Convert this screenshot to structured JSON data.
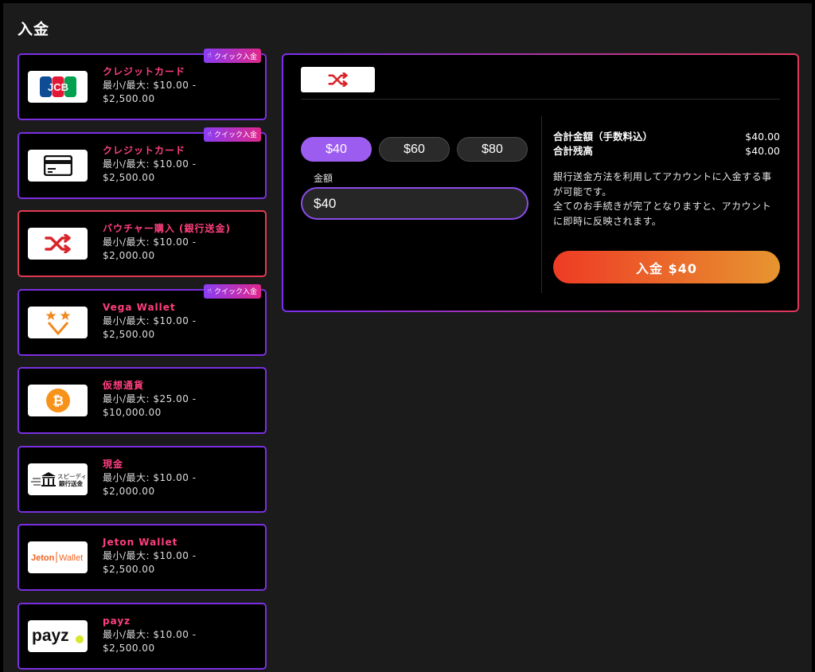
{
  "page": {
    "title": "入金"
  },
  "methods": [
    {
      "name": "クレジットカード",
      "limits": "最小/最大: $10.00 -",
      "limits_max": "$2,500.00",
      "quick": "クイック入金",
      "logo": "jcb-logo",
      "logo_text": "JCB"
    },
    {
      "name": "クレジットカード",
      "limits": "最小/最大: $10.00 -",
      "limits_max": "$2,500.00",
      "quick": "クイック入金",
      "logo": "card-icon"
    },
    {
      "name": "バウチャー購入 (銀行送金)",
      "limits": "最小/最大: $10.00 -",
      "limits_max": "$2,000.00",
      "logo": "shuffle-icon",
      "selected": true
    },
    {
      "name": "Vega Wallet",
      "limits": "最小/最大: $10.00 -",
      "limits_max": "$2,500.00",
      "quick": "クイック入金",
      "logo": "vega-wallet-logo"
    },
    {
      "name": "仮想通貨",
      "limits": "最小/最大: $25.00 -",
      "limits_max": "$10,000.00",
      "logo": "bitcoin-icon",
      "logo_text": "₿"
    },
    {
      "name": "現金",
      "limits": "最小/最大: $10.00 -",
      "limits_max": "$2,000.00",
      "logo": "speedy-bank-transfer-logo",
      "logo_text": "スピーディー",
      "logo_text2": "銀行送金"
    },
    {
      "name": "Jeton Wallet",
      "limits": "最小/最大: $10.00 -",
      "limits_max": "$2,500.00",
      "logo": "jeton-wallet-logo",
      "logo_text": "Jeton",
      "logo_text2": "Wallet"
    },
    {
      "name": "payz",
      "limits": "最小/最大: $10.00 -",
      "limits_max": "$2,500.00",
      "logo": "payz-logo",
      "logo_text": "payz"
    }
  ],
  "panel": {
    "presets": [
      "$40",
      "$60",
      "$80"
    ],
    "active_preset": "$40",
    "amount_label": "金額",
    "amount_value": "$40",
    "total_label": "合計金額（手数料込）",
    "total_value": "$40.00",
    "balance_label": "合計残高",
    "balance_value": "$40.00",
    "desc1": "銀行送金方法を利用してアカウントに入金する事が可能です。",
    "desc2": "全てのお手続きが完了となりますと、アカウントに即時に反映されます。",
    "submit_label": "入金 $40"
  },
  "colors": {
    "accent_purple": "#7b2fe0",
    "accent_red": "#e23a52",
    "method_name": "#ff3f7d",
    "submit_start": "#ee3b25",
    "submit_end": "#e79530"
  }
}
